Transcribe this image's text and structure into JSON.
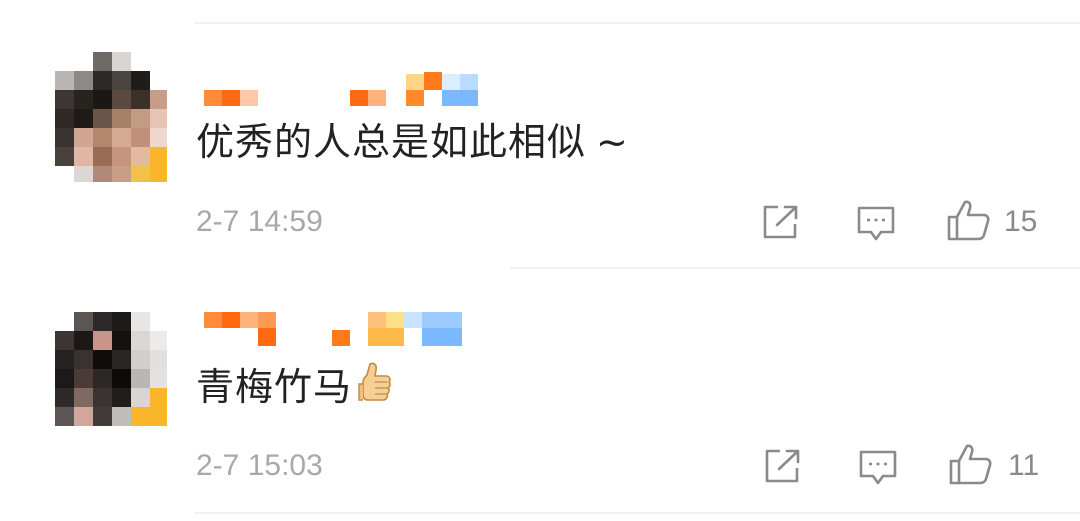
{
  "comments": [
    {
      "text": "优秀的人总是如此相似",
      "suffix": "~",
      "time": "2-7 14:59",
      "likes": "15",
      "icons": [
        "share-icon",
        "reply-icon",
        "like-icon"
      ]
    },
    {
      "text": "青梅竹马",
      "emoji": "thumbs-up-emoji",
      "time": "2-7 15:03",
      "likes": "11",
      "icons": [
        "share-icon",
        "reply-icon",
        "like-icon"
      ]
    }
  ],
  "colors": {
    "text": "#222222",
    "meta": "#a8a8a8",
    "icon": "#8a8a8a",
    "divider": "#f0f0f0",
    "name_orange": "#ff7a1a",
    "name_light_orange": "#ffb27a",
    "name_yellow": "#ffd36b",
    "name_blue": "#7ab8ff"
  }
}
